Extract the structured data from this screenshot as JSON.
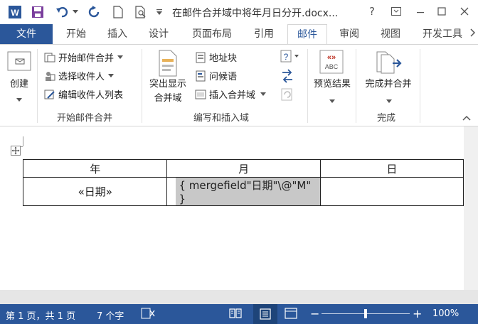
{
  "app": {
    "doc_title": "在邮件合并域中将年月日分开.docx...",
    "help_label": "?",
    "window_buttons": {
      "ribbon": "ribbon-display-icon",
      "minimize": "minimize-icon",
      "maximize": "maximize-icon",
      "close": "close-icon"
    }
  },
  "tabs": [
    {
      "label": "文件"
    },
    {
      "label": "开始"
    },
    {
      "label": "插入"
    },
    {
      "label": "设计"
    },
    {
      "label": "页面布局"
    },
    {
      "label": "引用"
    },
    {
      "label": "邮件",
      "active": true
    },
    {
      "label": "审阅"
    },
    {
      "label": "视图"
    },
    {
      "label": "开发工具"
    }
  ],
  "ribbon": {
    "create": {
      "label": "创建"
    },
    "start_group": {
      "label": "开始邮件合并",
      "items": [
        "开始邮件合并",
        "选择收件人",
        "编辑收件人列表"
      ]
    },
    "write_group": {
      "label": "编写和插入域",
      "highlight_label_1": "突出显示",
      "highlight_label_2": "合并域",
      "items": [
        "地址块",
        "问候语",
        "插入合并域"
      ]
    },
    "preview": {
      "label": "预览结果",
      "icon_text": "ABC",
      "icon_top": "«»"
    },
    "finish_group": {
      "label": "完成",
      "button_label": "完成并合并"
    }
  },
  "table": {
    "headers": [
      "年",
      "月",
      "日"
    ],
    "row": [
      "«日期»",
      "{ mergefield\"日期\"\\@\"M\" }",
      ""
    ]
  },
  "status": {
    "page": "第 1 页，共 1 页",
    "words": "7 个字",
    "zoom": "100%",
    "zoom_minus": "−",
    "zoom_plus": "+"
  },
  "colors": {
    "accent": "#2b579a",
    "word_icon": "#2b579a"
  }
}
